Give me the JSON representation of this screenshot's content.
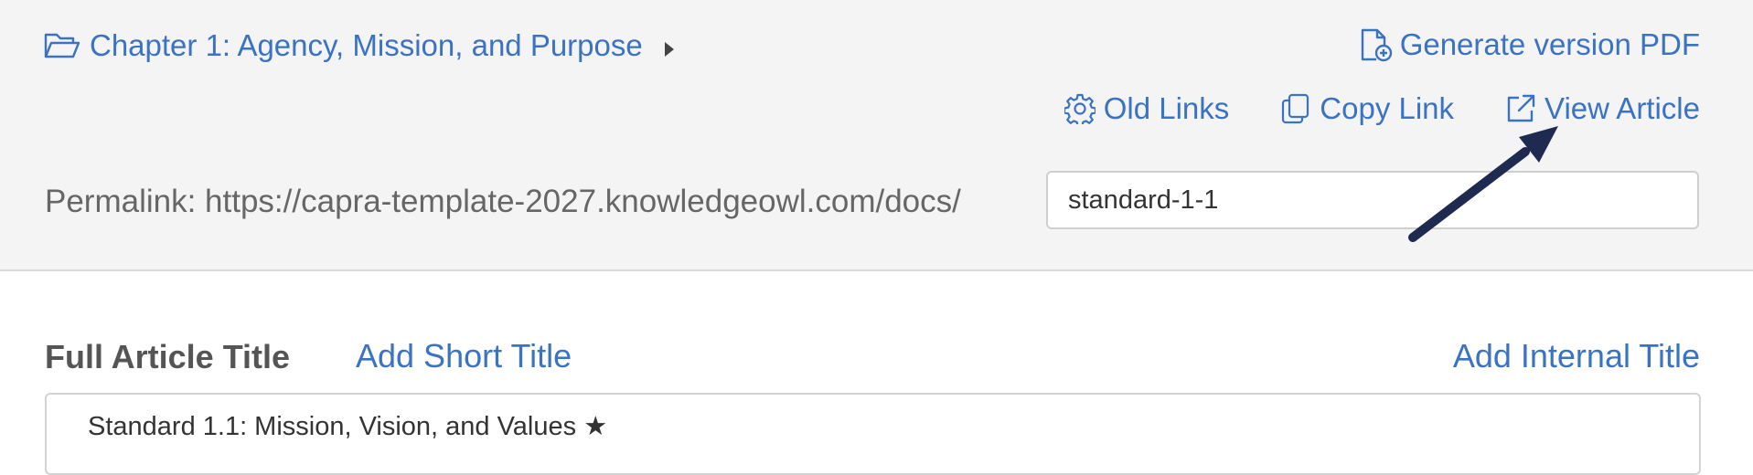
{
  "breadcrumb": {
    "chapter_label": "Chapter 1: Agency, Mission, and Purpose",
    "icon": "folder-open-icon",
    "caret_icon": "caret-right-icon"
  },
  "toolbar": {
    "generate_pdf_label": "Generate version PDF",
    "old_links_label": "Old Links",
    "copy_link_label": "Copy Link",
    "view_article_label": "View Article",
    "icons": {
      "generate_pdf": "file-plus-icon",
      "old_links": "gear-icon",
      "copy_link": "copy-icon",
      "view_article": "external-link-icon"
    }
  },
  "permalink": {
    "prefix": "Permalink: https://capra-template-2027.knowledgeowl.com/docs/",
    "slug": "standard-1-1"
  },
  "title_section": {
    "full_title_label": "Full Article Title",
    "add_short_title_label": "Add Short Title",
    "add_internal_title_label": "Add Internal Title",
    "full_title_value": "Standard 1.1: Mission, Vision, and Values ★"
  },
  "colors": {
    "link": "#3b73c4",
    "header_bg": "#f4f4f4",
    "annotation_arrow": "#1e2a4f"
  }
}
